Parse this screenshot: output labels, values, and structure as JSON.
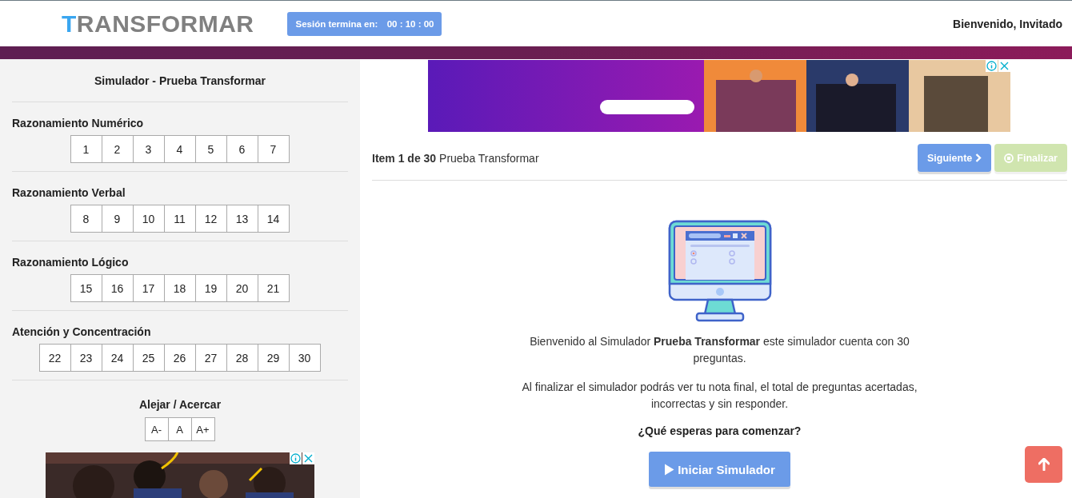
{
  "header": {
    "logo": "TRANSFORMAR",
    "session_label": "Sesión termina en:",
    "session_time": "00 : 10 : 00",
    "greeting": "Bienvenido, Invitado"
  },
  "sidebar": {
    "title": "Simulador - Prueba Transformar",
    "sections": [
      {
        "heading": "Razonamiento Numérico",
        "items": [
          "1",
          "2",
          "3",
          "4",
          "5",
          "6",
          "7"
        ]
      },
      {
        "heading": "Razonamiento Verbal",
        "items": [
          "8",
          "9",
          "10",
          "11",
          "12",
          "13",
          "14"
        ]
      },
      {
        "heading": "Razonamiento Lógico",
        "items": [
          "15",
          "16",
          "17",
          "18",
          "19",
          "20",
          "21"
        ]
      },
      {
        "heading": "Atención y Concentración",
        "items": [
          "22",
          "23",
          "24",
          "25",
          "26",
          "27",
          "28",
          "29",
          "30"
        ]
      }
    ],
    "zoom": {
      "heading": "Alejar / Acercar",
      "buttons": [
        "A-",
        "A",
        "A+"
      ]
    },
    "ad": {
      "kind": "picture"
    }
  },
  "main": {
    "ad": {
      "kind": "picture"
    },
    "item": {
      "counter": "Item 1 de 30",
      "test": "Prueba Transformar"
    },
    "buttons": [
      {
        "label": "Siguiente",
        "kind": "next",
        "disabled": false
      },
      {
        "label": "Finalizar",
        "kind": "finish",
        "disabled": true
      }
    ],
    "paragraphs": [
      "Bienvenido al Simulador **Prueba Transformar** este simulador cuenta con 30 preguntas.",
      "Al finalizar el simulador podrás ver tu nota final, el total de preguntas acertadas, incorrectas y sin responder."
    ],
    "question": "¿Qué esperas para comenzar?",
    "start_button": "Iniciar Simulador"
  }
}
